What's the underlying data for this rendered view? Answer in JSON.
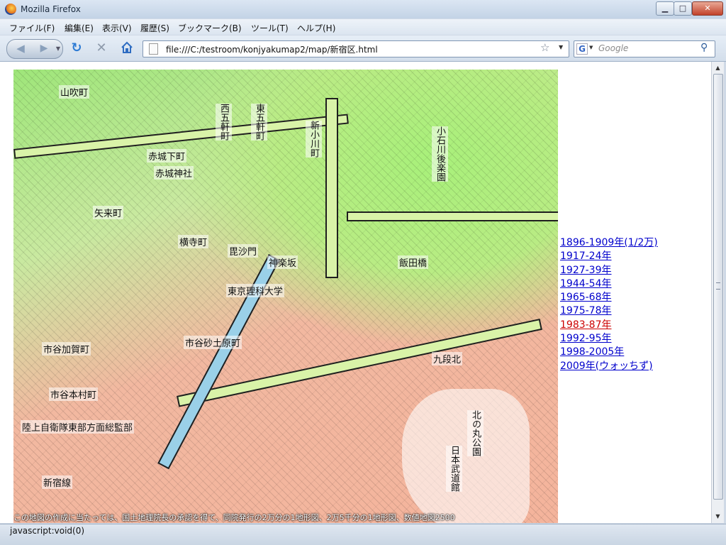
{
  "window": {
    "title": "Mozilla Firefox"
  },
  "menu": [
    "ファイル(F)",
    "編集(E)",
    "表示(V)",
    "履歴(S)",
    "ブックマーク(B)",
    "ツール(T)",
    "ヘルプ(H)"
  ],
  "nav": {
    "url": "file:///C:/testroom/konjyakumap2/map/新宿区.html",
    "search_placeholder": "Google",
    "search_engine_letter": "G"
  },
  "map": {
    "labels": [
      "山吹町",
      "西五軒町",
      "東五軒町",
      "新小川町",
      "小石川後楽園",
      "赤城下町",
      "赤城神社",
      "矢来町",
      "横寺町",
      "毘沙門",
      "神楽坂",
      "飯田橋",
      "東京理科大学",
      "市谷加賀町",
      "市谷砂土原町",
      "九段北",
      "市谷本村町",
      "陸上自衛隊東部方面総監部",
      "北の丸公園",
      "日本武道館",
      "新宿線"
    ],
    "credit": "この地図の作成に当たっては、国土地理院長の承認を得て、同院発行の2万分の1地形図、2万5千分の1地形図、数値地図2500"
  },
  "years": {
    "links": [
      "1896-1909年(1/2万)",
      "1917-24年",
      "1927-39年",
      "1944-54年",
      "1965-68年",
      "1975-78年",
      "1983-87年",
      "1992-95年",
      "1998-2005年",
      "2009年(ウォッちず)"
    ],
    "active_index": 6,
    "link_color": "#0000cc",
    "active_color": "#cc0000"
  },
  "status": {
    "text": "javascript:void(0)"
  }
}
